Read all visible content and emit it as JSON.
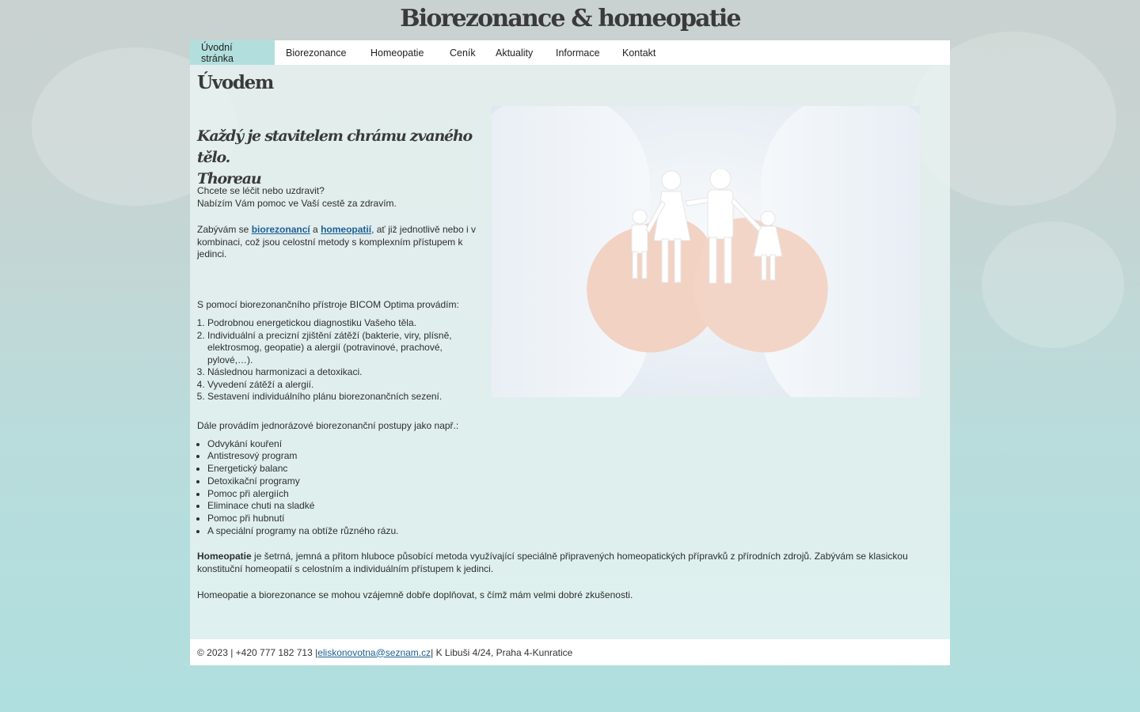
{
  "site": {
    "title": "Biorezonance & homeopatie"
  },
  "nav": {
    "items": [
      {
        "label": "Úvodní stránka"
      },
      {
        "label": "Biorezonance"
      },
      {
        "label": "Homeopatie"
      },
      {
        "label": "Ceník"
      },
      {
        "label": "Aktuality"
      },
      {
        "label": "Informace"
      },
      {
        "label": "Kontakt"
      }
    ]
  },
  "page": {
    "heading": "Úvodem",
    "quote_line1": "Každý je stavitelem chrámu zvaného tělo.",
    "quote_line2": "Thoreau",
    "intro_line1": "Chcete se léčit nebo uzdravit?",
    "intro_line2": "Nabízím Vám pomoc ve Vaší cestě za zdravím.",
    "p2_before": "Zabývám se ",
    "p2_link1": "biorezonancí",
    "p2_mid": " a ",
    "p2_link2": "homeopatií",
    "p2_after": ", ať již jednotlivě nebo i v kombinaci, což jsou celostní metody s komplexním přístupem k jedinci.",
    "bicom_intro": "S pomocí biorezonančního přístroje BICOM Optima provádím:",
    "steps": [
      "Podrobnou energetickou diagnostiku Vašeho těla.",
      "Individuální a precizní zjištění zátěží (bakterie, viry, plísně, elektrosmog, geopatie) a alergií (potravinové, prachové, pylové,…).",
      "Následnou harmonizaci a detoxikaci.",
      "Vyvedení zátěží a alergií.",
      "Sestavení individuálního plánu biorezonančních sezení."
    ],
    "programs_intro": "Dále provádím jednorázové biorezonanční postupy jako např.:",
    "programs": [
      "Odvykání kouření",
      "Antistresový program",
      "Energetický balanc",
      "Detoxikační programy",
      "Pomoc při alergiích",
      "Eliminace chuti na sladké",
      "Pomoc při hubnutí",
      "A speciální programy na obtíže různého rázu."
    ],
    "homeo_bold": "Homeopatie",
    "homeo_text": " je šetrná, jemná a přitom hluboce působící metoda využívající speciálně připravených homeopatických přípravků z  přírodních zdrojů. Zabývám se klasickou konstituční homeopatií s celostním a individuálním přístupem k jedinci.",
    "closing": "Homeopatie a biorezonance se mohou vzájemně dobře doplňovat, s čímž mám velmi dobré zkušenosti."
  },
  "footer": {
    "prefix": "© 2023 | +420 777 182 713 | ",
    "email": "eliskonovotna@seznam.cz",
    "suffix": " | K Libuši 4/24, Praha 4-Kunratice"
  },
  "colors": {
    "nav_active": "#b2dfdd",
    "link": "#1c5f95"
  }
}
